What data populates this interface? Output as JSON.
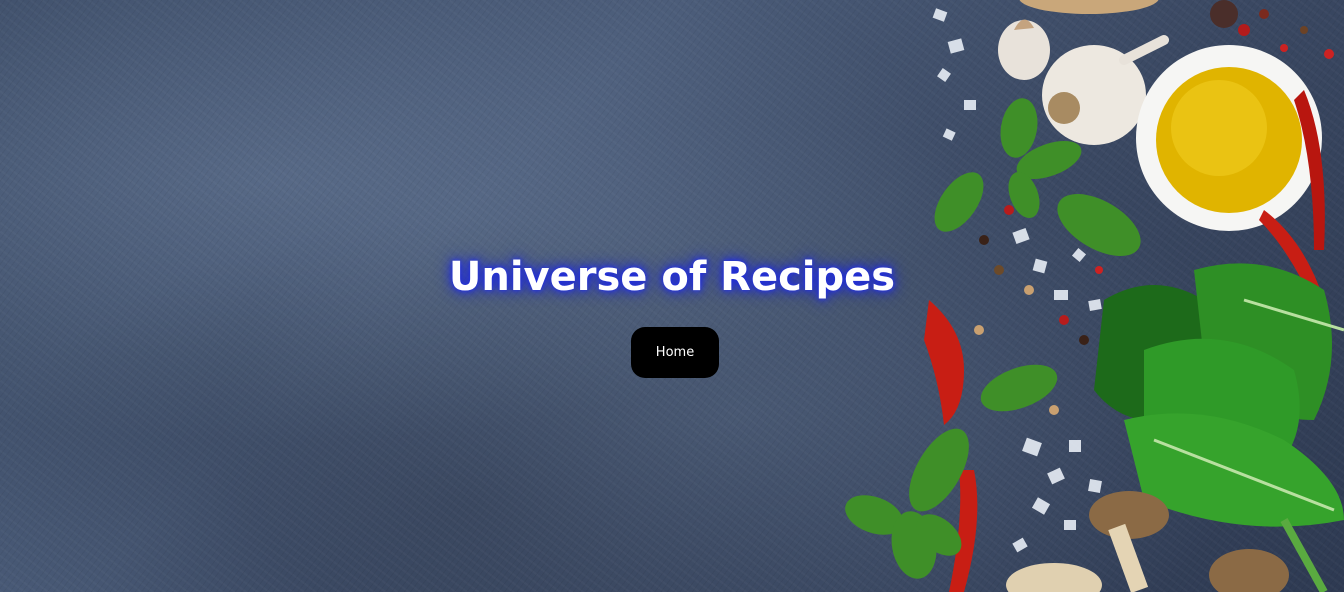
{
  "hero": {
    "title": "Universe of Recipes",
    "title_glow_color": "#1f2bd6",
    "background_color": "#3d4d68"
  },
  "nav": {
    "home_label": "Home"
  },
  "decor": {
    "icons": [
      "garlic-icon",
      "olive-oil-bowl-icon",
      "basil-leaf-icon",
      "chili-pepper-icon",
      "sea-salt-icon",
      "peppercorn-icon",
      "spinach-icon",
      "mushroom-icon"
    ]
  }
}
